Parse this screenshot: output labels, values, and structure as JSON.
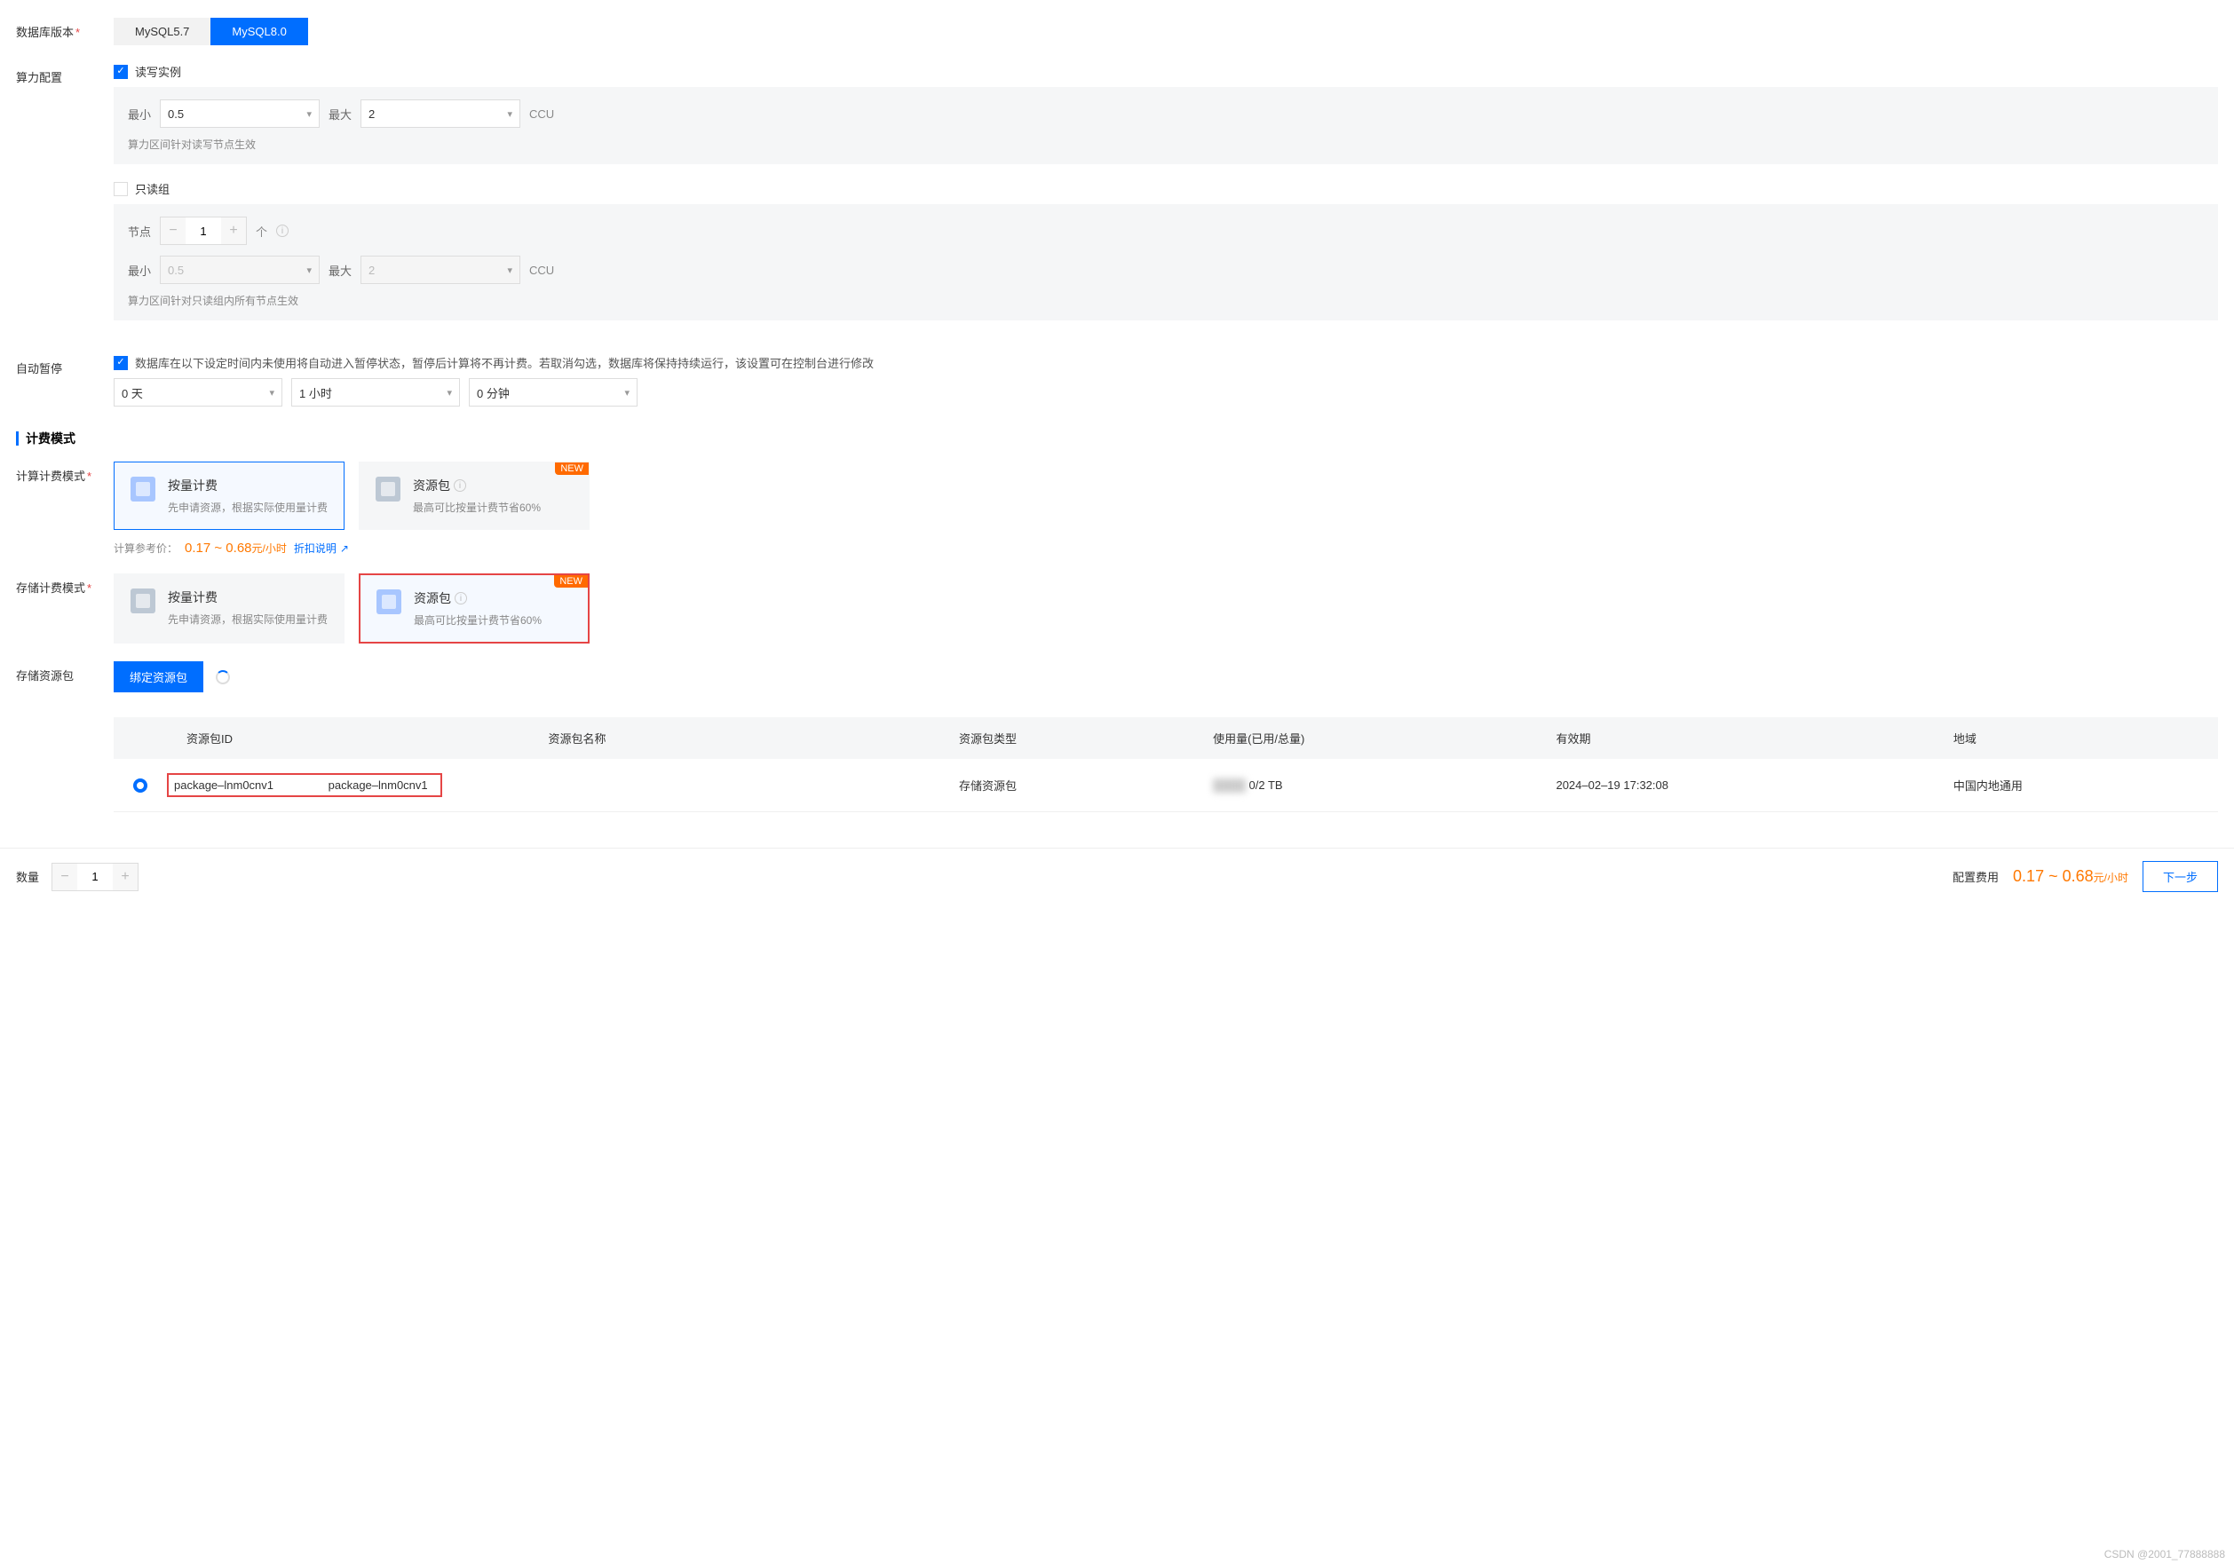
{
  "dbVersion": {
    "label": "数据库版本",
    "options": [
      "MySQL5.7",
      "MySQL8.0"
    ],
    "selectedIndex": 1
  },
  "computeConfig": {
    "label": "算力配置",
    "readWrite": {
      "checkboxLabel": "读写实例",
      "checked": true,
      "minLabel": "最小",
      "minValue": "0.5",
      "maxLabel": "最大",
      "maxValue": "2",
      "unit": "CCU",
      "note": "算力区间针对读写节点生效"
    },
    "readOnly": {
      "checkboxLabel": "只读组",
      "checked": false,
      "nodeLabel": "节点",
      "nodeValue": "1",
      "nodeUnit": "个",
      "minLabel": "最小",
      "minValue": "0.5",
      "maxLabel": "最大",
      "maxValue": "2",
      "unit": "CCU",
      "note": "算力区间针对只读组内所有节点生效"
    }
  },
  "autoPause": {
    "label": "自动暂停",
    "checked": true,
    "desc": "数据库在以下设定时间内未使用将自动进入暂停状态，暂停后计算将不再计费。若取消勾选，数据库将保持持续运行，该设置可在控制台进行修改",
    "day": "0 天",
    "hour": "1 小时",
    "minute": "0 分钟"
  },
  "billing": {
    "sectionTitle": "计费模式",
    "computeMode": {
      "label": "计算计费模式",
      "cards": [
        {
          "title": "按量计费",
          "sub": "先申请资源，根据实际使用量计费"
        },
        {
          "title": "资源包",
          "sub": "最高可比按量计费节省60%",
          "badge": "NEW"
        }
      ],
      "selectedIndex": 0,
      "refLabel": "计算参考价：",
      "refPrice": "0.17 ~ 0.68",
      "refUnit": "元/小时",
      "discountLink": "折扣说明"
    },
    "storageMode": {
      "label": "存储计费模式",
      "cards": [
        {
          "title": "按量计费",
          "sub": "先申请资源，根据实际使用量计费"
        },
        {
          "title": "资源包",
          "sub": "最高可比按量计费节省60%",
          "badge": "NEW"
        }
      ],
      "selectedIndex": 1
    },
    "storagePackage": {
      "label": "存储资源包",
      "bindBtn": "绑定资源包",
      "table": {
        "headers": [
          "资源包ID",
          "资源包名称",
          "资源包类型",
          "使用量(已用/总量)",
          "有效期",
          "地域"
        ],
        "row": {
          "id": "package–lnm0cnv1",
          "name": "package–lnm0cnv1",
          "type": "存储资源包",
          "usage": "0/2 TB",
          "expire": "2024–02–19 17:32:08",
          "region": "中国内地通用"
        }
      }
    }
  },
  "footer": {
    "qtyLabel": "数量",
    "qty": "1",
    "feeLabel": "配置费用",
    "feePrice": "0.17 ~ 0.68",
    "feeUnit": "元/小时",
    "nextBtn": "下一步"
  },
  "watermark": "CSDN @2001_77888888"
}
